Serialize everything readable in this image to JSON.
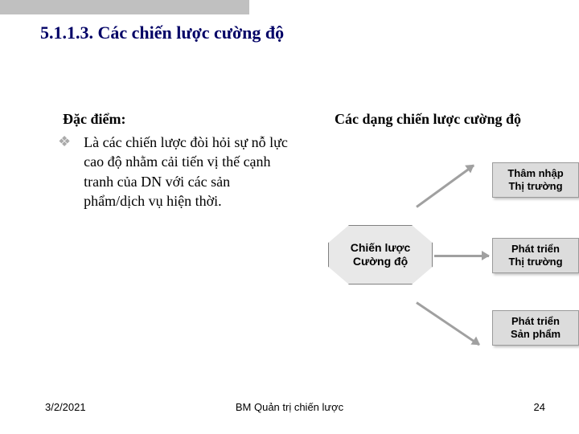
{
  "heading": "5.1.1.3. Các chiến lược cường độ",
  "left": {
    "title": "Đặc điểm:",
    "bullet": "Là các chiến lược đòi hỏi sự nỗ lực cao độ nhằm cải tiến vị thế cạnh tranh của DN với các sản phẩm/dịch vụ hiện thời."
  },
  "right": {
    "title": "Các dạng chiến lược cường độ",
    "center": {
      "line1": "Chiến lược",
      "line2": "Cường độ"
    },
    "boxes": [
      {
        "line1": "Thâm nhập",
        "line2": "Thị trường"
      },
      {
        "line1": "Phát triển",
        "line2": "Thị trường"
      },
      {
        "line1": "Phát triển",
        "line2": "Sản phẩm"
      }
    ]
  },
  "footer": {
    "date": "3/2/2021",
    "center": "BM Quản trị chiến lược",
    "page": "24"
  }
}
